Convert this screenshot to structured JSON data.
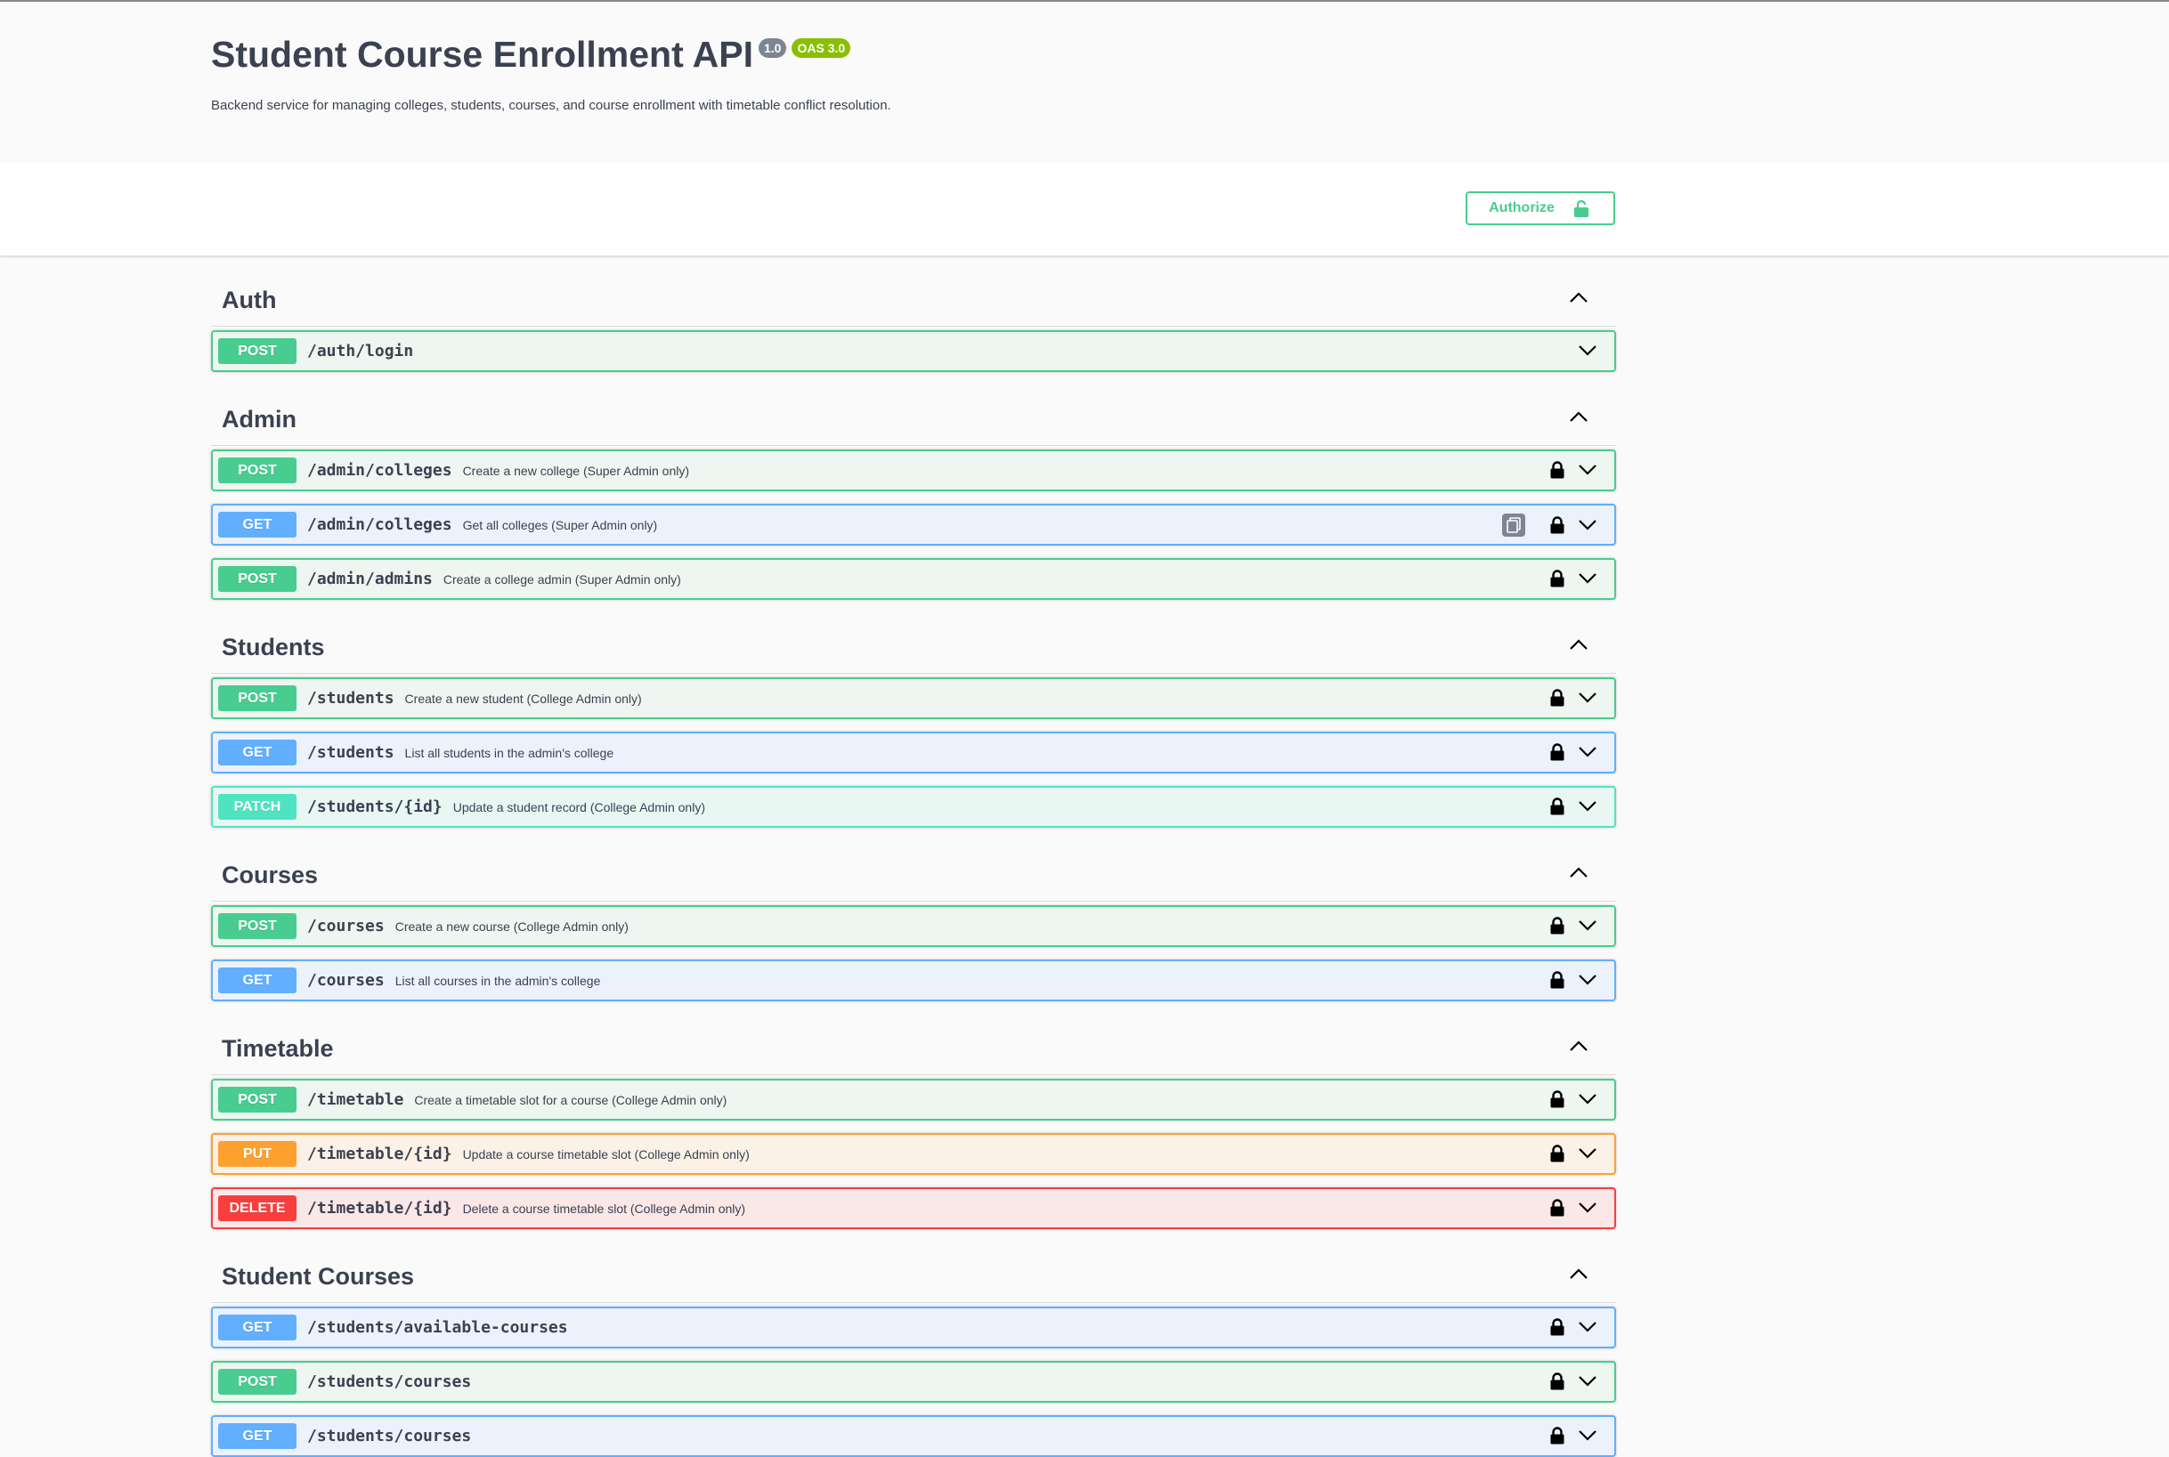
{
  "info": {
    "title": "Student Course Enrollment API",
    "version": "1.0",
    "oas": "OAS 3.0",
    "description": "Backend service for managing colleges, students, courses, and course enrollment with timetable conflict resolution."
  },
  "authorize_label": "Authorize",
  "colors": {
    "post": "#49cc90",
    "get": "#61affe",
    "patch": "#50e3c2",
    "put": "#fca130",
    "delete": "#f93e3e"
  },
  "tags": [
    {
      "name": "Auth",
      "ops": [
        {
          "method": "POST",
          "path": "/auth/login",
          "summary": "",
          "locked": false,
          "copy": false
        }
      ]
    },
    {
      "name": "Admin",
      "ops": [
        {
          "method": "POST",
          "path": "/admin/colleges",
          "summary": "Create a new college (Super Admin only)",
          "locked": true,
          "copy": false
        },
        {
          "method": "GET",
          "path": "/admin/colleges",
          "summary": "Get all colleges (Super Admin only)",
          "locked": true,
          "copy": true
        },
        {
          "method": "POST",
          "path": "/admin/admins",
          "summary": "Create a college admin (Super Admin only)",
          "locked": true,
          "copy": false
        }
      ]
    },
    {
      "name": "Students",
      "ops": [
        {
          "method": "POST",
          "path": "/students",
          "summary": "Create a new student (College Admin only)",
          "locked": true,
          "copy": false
        },
        {
          "method": "GET",
          "path": "/students",
          "summary": "List all students in the admin's college",
          "locked": true,
          "copy": false
        },
        {
          "method": "PATCH",
          "path": "/students/{id}",
          "summary": "Update a student record (College Admin only)",
          "locked": true,
          "copy": false
        }
      ]
    },
    {
      "name": "Courses",
      "ops": [
        {
          "method": "POST",
          "path": "/courses",
          "summary": "Create a new course (College Admin only)",
          "locked": true,
          "copy": false
        },
        {
          "method": "GET",
          "path": "/courses",
          "summary": "List all courses in the admin's college",
          "locked": true,
          "copy": false
        }
      ]
    },
    {
      "name": "Timetable",
      "ops": [
        {
          "method": "POST",
          "path": "/timetable",
          "summary": "Create a timetable slot for a course (College Admin only)",
          "locked": true,
          "copy": false
        },
        {
          "method": "PUT",
          "path": "/timetable/{id}",
          "summary": "Update a course timetable slot (College Admin only)",
          "locked": true,
          "copy": false
        },
        {
          "method": "DELETE",
          "path": "/timetable/{id}",
          "summary": "Delete a course timetable slot (College Admin only)",
          "locked": true,
          "copy": false
        }
      ]
    },
    {
      "name": "Student Courses",
      "ops": [
        {
          "method": "GET",
          "path": "/students/available-courses",
          "summary": "",
          "locked": true,
          "copy": false
        },
        {
          "method": "POST",
          "path": "/students/courses",
          "summary": "",
          "locked": true,
          "copy": false
        },
        {
          "method": "GET",
          "path": "/students/courses",
          "summary": "",
          "locked": true,
          "copy": false
        }
      ]
    }
  ]
}
